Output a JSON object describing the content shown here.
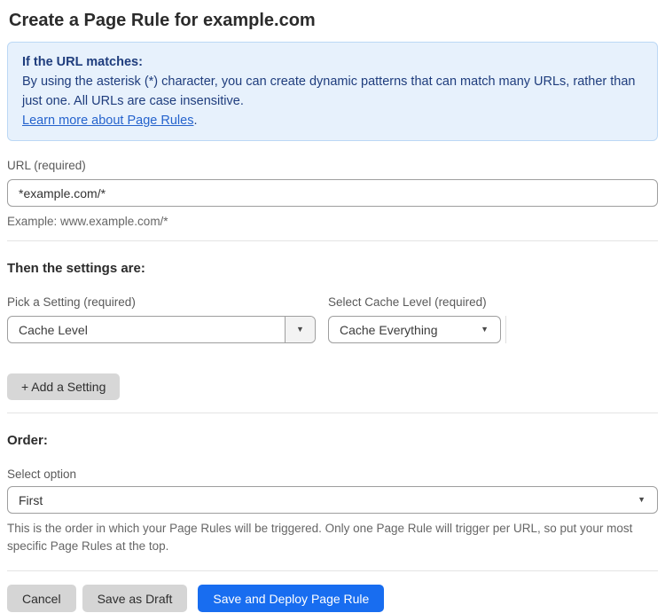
{
  "page": {
    "title": "Create a Page Rule for example.com"
  },
  "info_box": {
    "heading": "If the URL matches:",
    "body": "By using the asterisk (*) character, you can create dynamic patterns that can match many URLs, rather than just one. All URLs are case insensitive.",
    "link_label": "Learn more about Page Rules",
    "link_suffix": "."
  },
  "url_field": {
    "label": "URL (required)",
    "value": "*example.com/*",
    "example": "Example: www.example.com/*"
  },
  "settings_section": {
    "heading": "Then the settings are:",
    "setting_picker": {
      "label": "Pick a Setting (required)",
      "value": "Cache Level"
    },
    "cache_level_picker": {
      "label": "Select Cache Level (required)",
      "value": "Cache Everything"
    },
    "add_setting_label": "+ Add a Setting"
  },
  "order_section": {
    "heading": "Order:",
    "select_label": "Select option",
    "value": "First",
    "help_text": "This is the order in which your Page Rules will be triggered. Only one Page Rule will trigger per URL, so put your most specific Page Rules at the top."
  },
  "footer": {
    "cancel_label": "Cancel",
    "save_draft_label": "Save as Draft",
    "save_deploy_label": "Save and Deploy Page Rule"
  },
  "icons": {
    "dropdown_arrow": "▼"
  },
  "colors": {
    "accent_blue": "#186df0",
    "info_box_bg": "#e7f1fc",
    "info_box_border": "#bcd8f5",
    "info_text": "#1f3d7d",
    "link_blue": "#2563cd",
    "gray_button_bg": "#d5d5d5",
    "input_border": "#9e9e9e"
  }
}
